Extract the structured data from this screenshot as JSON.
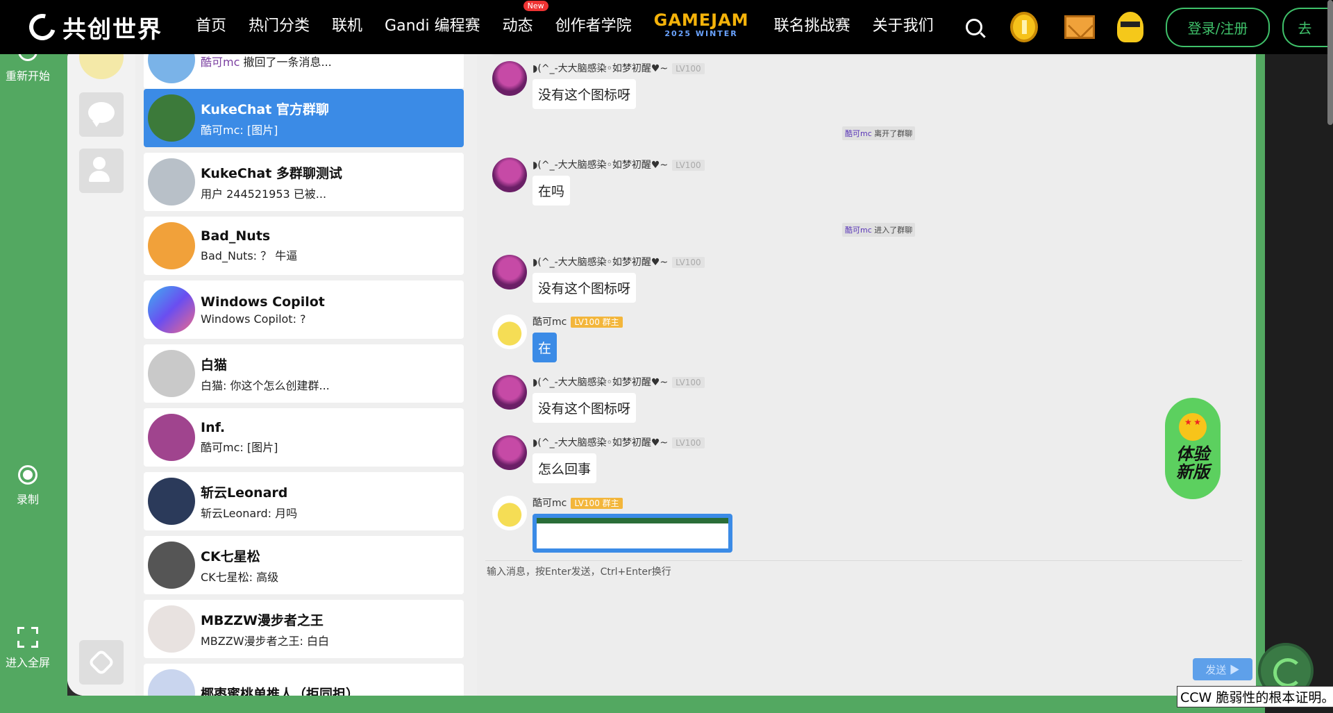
{
  "nav": {
    "logo": "共创世界",
    "links": [
      "首页",
      "热门分类",
      "联机",
      "Gandi 编程赛",
      "动态",
      "创作者学院"
    ],
    "new_badge": "New",
    "gamejam_title": "GAMEJAM",
    "gamejam_sub": "2025 WINTER",
    "links_after": [
      "联名挑战赛",
      "关于我们"
    ],
    "login": "登录/注册",
    "cut_button": "去"
  },
  "side_tools": {
    "restart": "重新开始",
    "record": "录制",
    "fullscreen": "进入全屏"
  },
  "conversations": [
    {
      "name": "",
      "who": "酷可mc",
      "preview": " 撤回了一条消息...",
      "avatar_color": "#7ab3e8"
    },
    {
      "name": "KukeChat 官方群聊",
      "who": "",
      "preview": "酷可mc: [图片]",
      "avatar_color": "#3c7a3a",
      "active": true
    },
    {
      "name": "KukeChat 多群聊测试",
      "who": "",
      "preview": "用户 244521953 已被...",
      "avatar_color": "#b8c0c8"
    },
    {
      "name": "Bad_Nuts",
      "who": "",
      "preview": "Bad_Nuts: ？ 牛逼",
      "avatar_color": "#f1a13a"
    },
    {
      "name": "Windows Copilot",
      "who": "",
      "preview": "Windows Copilot: ?",
      "avatar_color": "#6a7ef0"
    },
    {
      "name": "白猫",
      "who": "",
      "preview": "白猫: 你这个怎么创建群...",
      "avatar_color": "#c9c9c9"
    },
    {
      "name": "Inf.",
      "who": "",
      "preview": "酷可mc: [图片]",
      "avatar_color": "#a0448e"
    },
    {
      "name": "斩云Leonard",
      "who": "",
      "preview": "斩云Leonard: 月吗",
      "avatar_color": "#2b3a5a"
    },
    {
      "name": "CK七星松",
      "who": "",
      "preview": "CK七星松: 高级",
      "avatar_color": "#555555"
    },
    {
      "name": "MBZZW漫步者之王",
      "who": "",
      "preview": "MBZZW漫步者之王: 白白",
      "avatar_color": "#e8e2e0"
    },
    {
      "name": "椰枣蜜桃单推人（拒同担）",
      "who": "",
      "preview": "",
      "avatar_color": "#c9d5ee"
    }
  ],
  "messages": [
    {
      "kind": "msg",
      "sender": "◗(^_-大大脑感染◦如梦初醒♥~",
      "level": "LV100",
      "text": "没有这个图标呀"
    },
    {
      "kind": "sys",
      "who": "酷可mc",
      "text": " 离开了群聊"
    },
    {
      "kind": "msg",
      "sender": "◗(^_-大大脑感染◦如梦初醒♥~",
      "level": "LV100",
      "text": "在吗"
    },
    {
      "kind": "sys",
      "who": "酷可mc",
      "text": " 进入了群聊"
    },
    {
      "kind": "msg",
      "sender": "◗(^_-大大脑感染◦如梦初醒♥~",
      "level": "LV100",
      "text": "没有这个图标呀"
    },
    {
      "kind": "own",
      "sender": "酷可mc",
      "level": "LV100 群主",
      "text": "在"
    },
    {
      "kind": "msg",
      "sender": "◗(^_-大大脑感染◦如梦初醒♥~",
      "level": "LV100",
      "text": "没有这个图标呀"
    },
    {
      "kind": "msg",
      "sender": "◗(^_-大大脑感染◦如梦初醒♥~",
      "level": "LV100",
      "text": "怎么回事"
    },
    {
      "kind": "img",
      "sender": "酷可mc",
      "level": "LV100 群主",
      "text": ""
    }
  ],
  "input_placeholder": "输入消息，按Enter发送，Ctrl+Enter换行",
  "send_label": "发送 ▶",
  "try_new": {
    "line1": "体验",
    "line2": "新版"
  },
  "tooltip": "CCW 脆弱性的根本证明。"
}
